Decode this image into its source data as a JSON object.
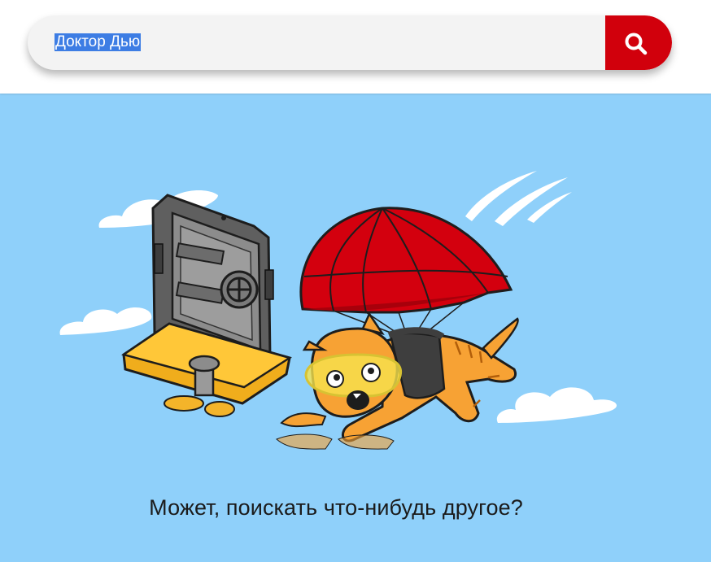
{
  "search": {
    "value": "Доктор Дью",
    "button_icon": "search-icon",
    "accent_color": "#d1000c"
  },
  "illustration": {
    "icon": "falling-cat-with-parachute-and-safe-illustration",
    "background_color": "#8fd0fa"
  },
  "message": {
    "text": "Может, поискать что-нибудь другое?"
  }
}
